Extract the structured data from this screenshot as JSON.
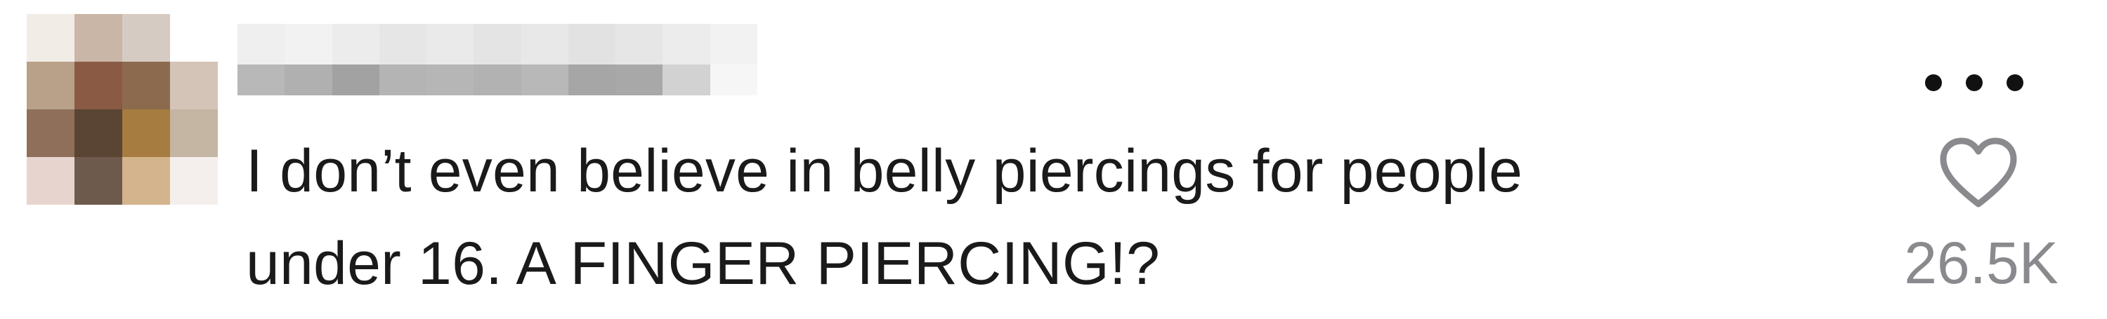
{
  "comment": {
    "avatar_colors": [
      "#f2ece6",
      "#c9b6a6",
      "#d6cbc2",
      "#ffffff",
      "#b9a088",
      "#8a5a44",
      "#8c6a4e",
      "#d4c4b8",
      "#8f6f5a",
      "#5a4434",
      "#a67c40",
      "#c5b5a3",
      "#e8d4ce",
      "#6e5a4c",
      "#d4b48c",
      "#f4efec"
    ],
    "username_blur_row1": [
      "#efefef",
      "#f2f2f2",
      "#ececec",
      "#e6e6e6",
      "#eaeaea",
      "#e4e4e4",
      "#e8e8e8",
      "#e2e2e2",
      "#e6e6e6",
      "#ececec",
      "#f2f2f2"
    ],
    "username_blur_row2": [
      "#b8b8b8",
      "#b0b0b0",
      "#a2a2a2",
      "#b4b4b4",
      "#b6b6b6",
      "#b2b2b2",
      "#b8b8b8",
      "#a6a6a6",
      "#a8a8a8",
      "#d2d2d2",
      "#f6f6f6"
    ],
    "text_line1": "I don’t even believe in belly piercings for people",
    "text_line2": "under 16. A FINGER PIERCING!?",
    "more_icon": "ellipsis-icon",
    "like_icon": "heart-outline-icon",
    "like_count": "26.5K",
    "colors": {
      "text": "#1a1a1a",
      "muted": "#8a8a8e",
      "icon": "#8a8a8e"
    }
  }
}
